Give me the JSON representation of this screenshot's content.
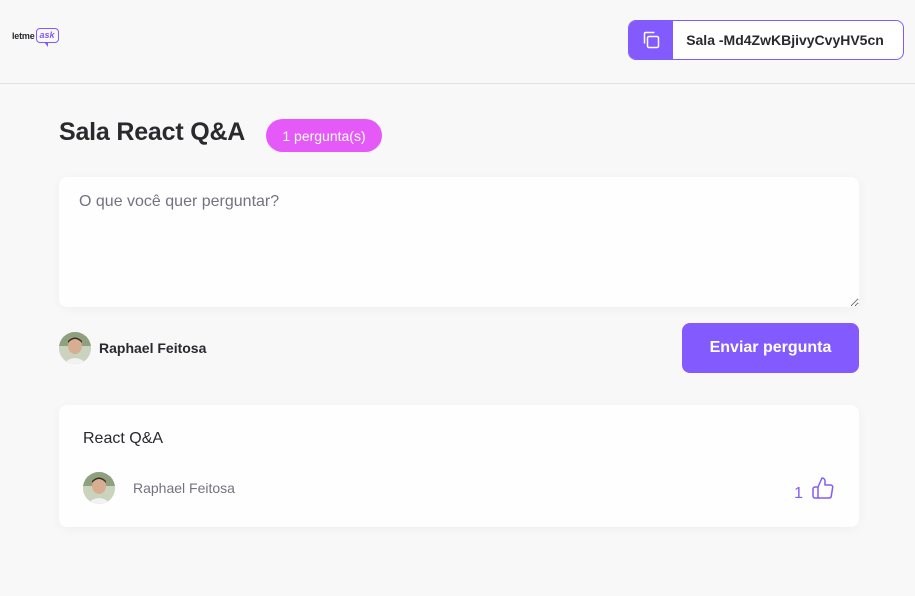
{
  "header": {
    "logo": {
      "word": "letme",
      "bubble": "ask"
    },
    "room_code": "Sala -Md4ZwKBjivyCvyHV5cn"
  },
  "room": {
    "title": "Sala React Q&A",
    "question_count": "1 pergunta(s)"
  },
  "form": {
    "placeholder": "O que você quer perguntar?",
    "user_name": "Raphael Feitosa",
    "send_label": "Enviar pergunta"
  },
  "questions": [
    {
      "content": "React Q&A",
      "author": "Raphael Feitosa",
      "likes": "1"
    }
  ],
  "colors": {
    "accent": "#835afd",
    "badge": "#e559f9",
    "background": "#f8f8f8"
  }
}
